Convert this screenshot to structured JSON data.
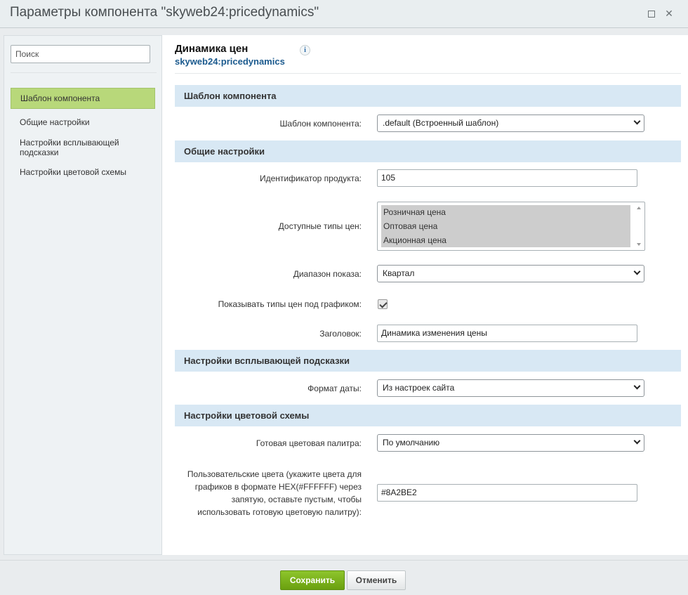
{
  "window": {
    "title": "Параметры компонента \"skyweb24:pricedynamics\"",
    "maximize_glyph": "",
    "close_glyph": "✕"
  },
  "sidebar": {
    "search_placeholder": "Поиск",
    "items": [
      {
        "label": "Шаблон компонента",
        "active": true
      },
      {
        "label": "Общие настройки",
        "active": false
      },
      {
        "label": "Настройки всплывающей подсказки",
        "active": false
      },
      {
        "label": "Настройки цветовой схемы",
        "active": false
      }
    ]
  },
  "component": {
    "title": "Динамика цен",
    "code": "skyweb24:pricedynamics",
    "info_icon": "i"
  },
  "sections": [
    {
      "title": "Шаблон компонента"
    },
    {
      "title": "Общие настройки"
    },
    {
      "title": "Настройки всплывающей подсказки"
    },
    {
      "title": "Настройки цветовой схемы"
    }
  ],
  "fields": {
    "template": {
      "label": "Шаблон компонента:",
      "value": ".default (Встроенный шаблон)"
    },
    "product_id": {
      "label": "Идентификатор продукта:",
      "value": "105"
    },
    "price_types": {
      "label": "Доступные типы цен:",
      "options": [
        "Розничная цена",
        "Оптовая цена",
        "Акционная цена"
      ]
    },
    "range": {
      "label": "Диапазон показа:",
      "value": "Квартал"
    },
    "show_types": {
      "label": "Показывать типы цен под графиком:",
      "checked": true
    },
    "heading": {
      "label": "Заголовок:",
      "value": "Динамика изменения цены"
    },
    "date_format": {
      "label": "Формат даты:",
      "value": "Из настроек сайта"
    },
    "palette": {
      "label": "Готовая цветовая палитра:",
      "value": "По умолчанию"
    },
    "custom_colors": {
      "label_lines": [
        "Пользовательские цвета (укажите цвета для",
        "графиков в формате HEX(#FFFFFF) через",
        "запятую, оставьте пустым, чтобы",
        "использовать готовую цветовую палитру):"
      ],
      "value": "#8A2BE2"
    }
  },
  "footer": {
    "save_label": "Сохранить",
    "cancel_label": "Отменить"
  },
  "colors": {
    "accent_green": "#7cb71d",
    "section_bg": "#d8e8f4",
    "active_item_bg": "#b8d87a",
    "link_blue": "#1b5a8e"
  }
}
